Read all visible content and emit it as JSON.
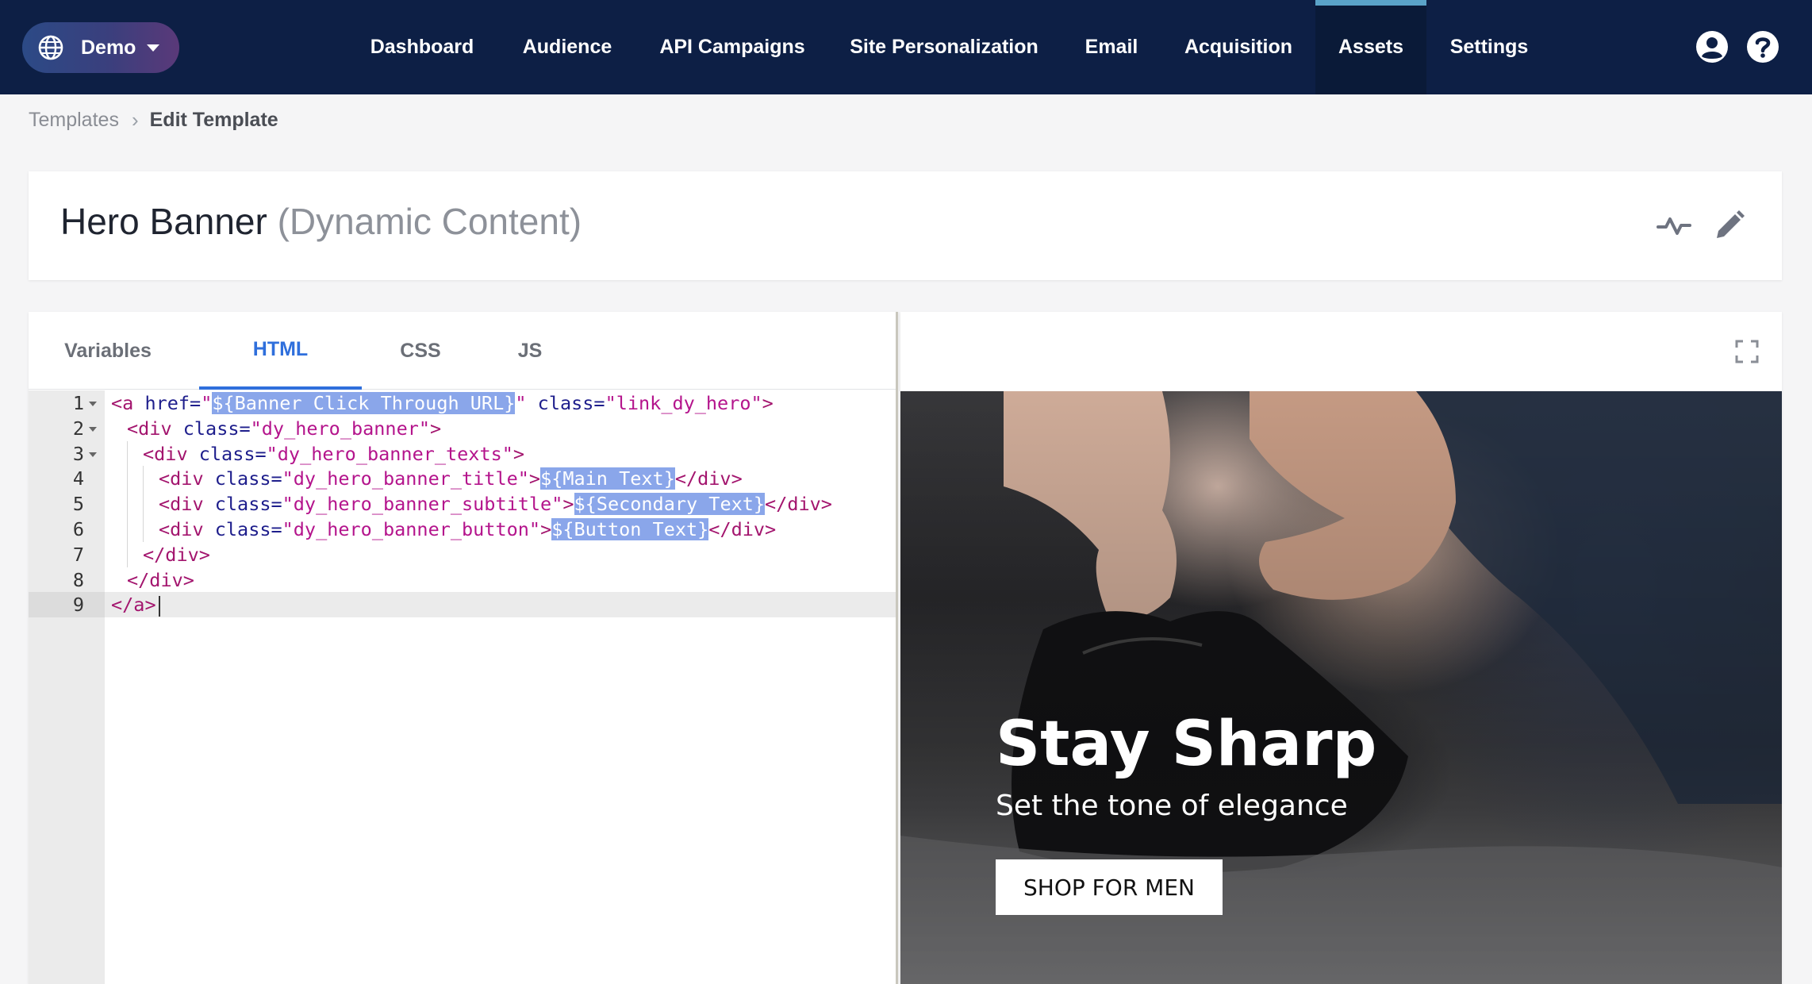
{
  "nav": {
    "workspace_label": "Demo",
    "items": [
      {
        "label": "Dashboard"
      },
      {
        "label": "Audience"
      },
      {
        "label": "API Campaigns"
      },
      {
        "label": "Site Personalization"
      },
      {
        "label": "Email"
      },
      {
        "label": "Acquisition"
      },
      {
        "label": "Assets",
        "active": true
      },
      {
        "label": "Settings"
      }
    ],
    "icons": [
      "globe-icon",
      "user-account-icon",
      "help-icon"
    ]
  },
  "breadcrumb": {
    "parent": "Templates",
    "separator": "›",
    "current": "Edit Template"
  },
  "header": {
    "title": "Hero Banner",
    "subtitle": "(Dynamic Content)",
    "icons": [
      "activity-icon",
      "pencil-icon"
    ]
  },
  "editor": {
    "tabs": [
      {
        "label": "Variables"
      },
      {
        "label": "HTML",
        "active": true
      },
      {
        "label": "CSS"
      },
      {
        "label": "JS"
      }
    ],
    "line_numbers": [
      "1",
      "2",
      "3",
      "4",
      "5",
      "6",
      "7",
      "8",
      "9"
    ],
    "lines": [
      {
        "parts": [
          [
            "tg",
            "<a "
          ],
          [
            "at",
            "href="
          ],
          [
            "st",
            "\""
          ],
          [
            "pl",
            "${Banner Click Through URL}"
          ],
          [
            "st",
            "\""
          ],
          [
            "at",
            " class="
          ],
          [
            "st",
            "\"link_dy_hero\""
          ],
          [
            "tg",
            ">"
          ]
        ]
      },
      {
        "parts": [
          [
            "tg",
            "<div "
          ],
          [
            "at",
            "class="
          ],
          [
            "st",
            "\"dy_hero_banner\""
          ],
          [
            "tg",
            ">"
          ]
        ]
      },
      {
        "parts": [
          [
            "tg",
            "<div "
          ],
          [
            "at",
            "class="
          ],
          [
            "st",
            "\"dy_hero_banner_texts\""
          ],
          [
            "tg",
            ">"
          ]
        ]
      },
      {
        "parts": [
          [
            "tg",
            "<div "
          ],
          [
            "at",
            "class="
          ],
          [
            "st",
            "\"dy_hero_banner_title\""
          ],
          [
            "tg",
            ">"
          ],
          [
            "pl",
            "${Main Text}"
          ],
          [
            "tg",
            "</div>"
          ]
        ]
      },
      {
        "parts": [
          [
            "tg",
            "<div "
          ],
          [
            "at",
            "class="
          ],
          [
            "st",
            "\"dy_hero_banner_subtitle\""
          ],
          [
            "tg",
            ">"
          ],
          [
            "pl",
            "${Secondary Text}"
          ],
          [
            "tg",
            "</div>"
          ]
        ]
      },
      {
        "parts": [
          [
            "tg",
            "<div "
          ],
          [
            "at",
            "class="
          ],
          [
            "st",
            "\"dy_hero_banner_button\""
          ],
          [
            "tg",
            ">"
          ],
          [
            "pl",
            "${Button Text}"
          ],
          [
            "tg",
            "</div>"
          ]
        ]
      },
      {
        "parts": [
          [
            "tg",
            "</div>"
          ]
        ]
      },
      {
        "parts": [
          [
            "tg",
            "</div>"
          ]
        ]
      },
      {
        "parts": [
          [
            "tg",
            "</a>"
          ]
        ]
      }
    ]
  },
  "preview": {
    "title": "Stay Sharp",
    "subtitle": "Set the tone of elegance",
    "button": "SHOP FOR MEN",
    "icons": [
      "fullscreen-icon"
    ]
  },
  "colors": {
    "nav_bg": "#0d1f45",
    "active_tab": "#2f6fdc",
    "placeholder_highlight": "#8aa6ea"
  }
}
